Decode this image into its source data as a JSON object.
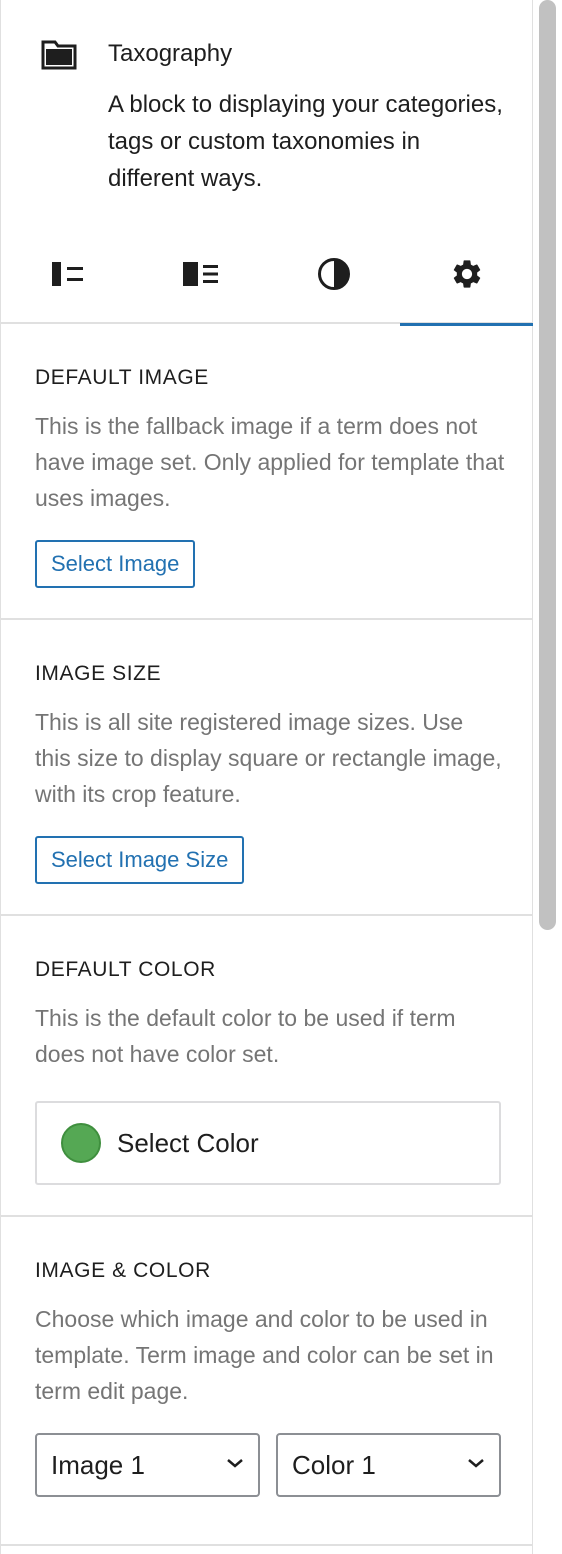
{
  "block": {
    "icon": "folder-icon",
    "title": "Taxography",
    "description": "A block to displaying your categories, tags or custom taxonomies in different ways."
  },
  "tabs": [
    {
      "icon": "layout-list-icon",
      "active": false
    },
    {
      "icon": "layout-grid-icon",
      "active": false
    },
    {
      "icon": "contrast-icon",
      "active": false
    },
    {
      "icon": "gear-icon",
      "active": true
    }
  ],
  "sections": {
    "default_image": {
      "heading": "DEFAULT IMAGE",
      "help": "This is the fallback image if a term does not have image set. Only applied for template that uses images.",
      "button": "Select Image"
    },
    "image_size": {
      "heading": "IMAGE SIZE",
      "help": "This is all site registered image sizes. Use this size to display square or rectangle image, with its crop feature.",
      "button": "Select Image Size"
    },
    "default_color": {
      "heading": "DEFAULT COLOR",
      "help": "This is the default color to be used if term does not have color set.",
      "picker_label": "Select Color",
      "swatch_color": "#55a854"
    },
    "image_color": {
      "heading": "IMAGE & COLOR",
      "help": "Choose which image and color to be used in template. Term image and color can be set in term edit page.",
      "image_select": "Image 1",
      "color_select": "Color 1"
    }
  },
  "colors": {
    "accent": "#2271b1",
    "help_text": "#757575",
    "border": "#e0e0e0"
  }
}
